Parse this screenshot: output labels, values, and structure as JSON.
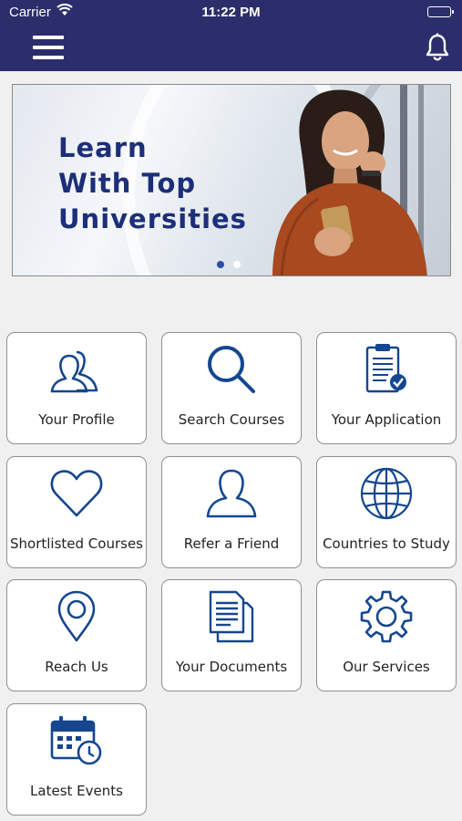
{
  "status_bar": {
    "carrier": "Carrier",
    "time": "11:22 PM"
  },
  "nav": {
    "menu_icon": "hamburger-menu-icon",
    "bell_icon": "notification-bell-icon"
  },
  "banner": {
    "line1": "Learn",
    "line2": "With Top",
    "line3": "Universities",
    "slide_count": 2,
    "active_slide": 1
  },
  "colors": {
    "nav_bg": "#2b2e6b",
    "icon_blue": "#15468f",
    "headline_blue": "#1c2f78"
  },
  "tiles": [
    {
      "label": "Your Profile",
      "icon": "users-icon"
    },
    {
      "label": "Search Courses",
      "icon": "search-icon"
    },
    {
      "label": "Your Application",
      "icon": "clipboard-check-icon"
    },
    {
      "label": "Shortlisted Courses",
      "icon": "heart-icon"
    },
    {
      "label": "Refer a Friend",
      "icon": "user-icon"
    },
    {
      "label": "Countries to Study",
      "icon": "globe-icon"
    },
    {
      "label": "Reach Us",
      "icon": "location-pin-icon"
    },
    {
      "label": "Your Documents",
      "icon": "documents-icon"
    },
    {
      "label": "Our Services",
      "icon": "gear-icon"
    },
    {
      "label": "Latest Events",
      "icon": "calendar-clock-icon"
    }
  ]
}
